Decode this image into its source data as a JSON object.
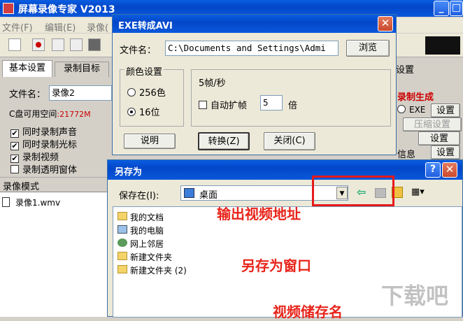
{
  "main": {
    "title": "屏幕录像专家  V2013",
    "menu": [
      "文件(F)",
      "编辑(E)",
      "录像("
    ],
    "tabs": [
      "基本设置",
      "录制目标"
    ],
    "filename_label": "文件名：",
    "filename_value": "录像2",
    "disk_label": "C盘可用空间",
    "disk_value": ":21772M",
    "checks": [
      {
        "label": "同时录制声音",
        "checked": true
      },
      {
        "label": "同时录制光标",
        "checked": true
      },
      {
        "label": "录制视频",
        "checked": true
      },
      {
        "label": "录制透明窗体",
        "checked": false
      }
    ],
    "mode_label": "录像模式",
    "file_item": "录像1.wmv",
    "right_tab": "设置",
    "gen_label": "录制生成",
    "exe_label": "EXE",
    "btn_settings": "设置",
    "btn_compress": "压缩设置",
    "btn_settings2": "设置",
    "info_label": "信息",
    "btn_settings3": "设置"
  },
  "exe_dialog": {
    "title": "EXE转成AVI",
    "filename_label": "文件名：",
    "filename_value": "C:\\Documents and Settings\\Admi",
    "browse": "浏览",
    "color_group": "颜色设置",
    "color_256": "256色",
    "color_16": "16位",
    "fps": "5帧/秒",
    "auto_expand": "自动扩帧",
    "times_value": "5",
    "times_unit": "倍",
    "btn_help": "说明",
    "btn_convert": "转换(Z)",
    "btn_close": "关闭(C)"
  },
  "save_dialog": {
    "title": "另存为",
    "help": "?",
    "save_in_label": "保存在(I):",
    "location": "桌面",
    "items": [
      "我的文档",
      "我的电脑",
      "网上邻居",
      "新建文件夹",
      "新建文件夹 (2)"
    ]
  },
  "annotations": {
    "a1": "输出视频地址",
    "a2": "另存为窗口",
    "a3": "视频储存名"
  },
  "watermark": "下载吧"
}
